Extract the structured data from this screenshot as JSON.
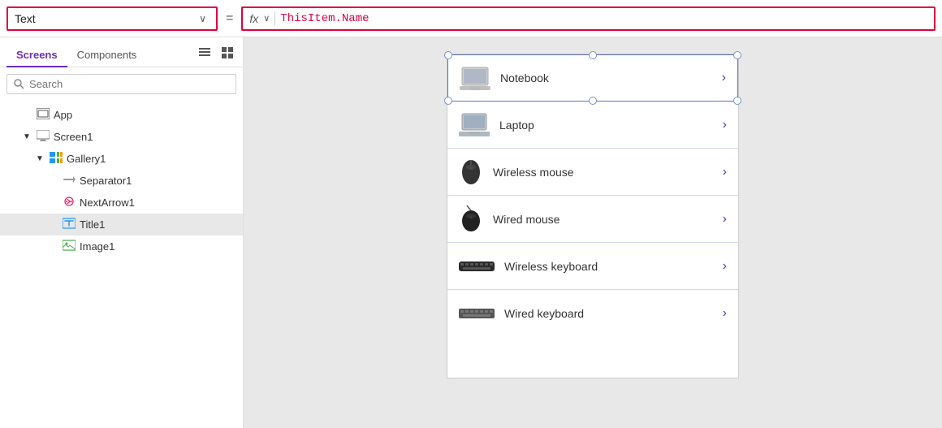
{
  "topbar": {
    "property_label": "Text",
    "equals": "=",
    "fx_label": "fx",
    "formula_value": "ThisItem.Name",
    "chevron_symbol": "∨"
  },
  "left_panel": {
    "tabs": [
      {
        "id": "screens",
        "label": "Screens",
        "active": true
      },
      {
        "id": "components",
        "label": "Components",
        "active": false
      }
    ],
    "search_placeholder": "Search",
    "tree": [
      {
        "id": "app",
        "label": "App",
        "indent": 0,
        "expandable": false,
        "icon": "app"
      },
      {
        "id": "screen1",
        "label": "Screen1",
        "indent": 0,
        "expandable": true,
        "expanded": true,
        "icon": "screen"
      },
      {
        "id": "gallery1",
        "label": "Gallery1",
        "indent": 1,
        "expandable": true,
        "expanded": true,
        "icon": "gallery"
      },
      {
        "id": "separator1",
        "label": "Separator1",
        "indent": 2,
        "expandable": false,
        "icon": "separator"
      },
      {
        "id": "nextarrow1",
        "label": "NextArrow1",
        "indent": 2,
        "expandable": false,
        "icon": "nextarrow"
      },
      {
        "id": "title1",
        "label": "Title1",
        "indent": 2,
        "expandable": false,
        "icon": "title",
        "selected": true
      },
      {
        "id": "image1",
        "label": "Image1",
        "indent": 2,
        "expandable": false,
        "icon": "image"
      }
    ]
  },
  "gallery": {
    "items": [
      {
        "id": "notebook",
        "label": "Notebook",
        "img": "notebook",
        "selected": true
      },
      {
        "id": "laptop",
        "label": "Laptop",
        "img": "laptop"
      },
      {
        "id": "wireless-mouse",
        "label": "Wireless mouse",
        "img": "wireless-mouse"
      },
      {
        "id": "wired-mouse",
        "label": "Wired mouse",
        "img": "wired-mouse"
      },
      {
        "id": "wireless-keyboard",
        "label": "Wireless keyboard",
        "img": "wireless-keyboard"
      },
      {
        "id": "wired-keyboard",
        "label": "Wired keyboard",
        "img": "wired-keyboard"
      }
    ]
  },
  "icons": {
    "search": "🔍",
    "expand": "▶",
    "collapse": "▼",
    "list_view": "≡",
    "grid_view": "⊞",
    "chevron_down": "∨",
    "chevron_right": "›",
    "arrow_right": "›"
  }
}
